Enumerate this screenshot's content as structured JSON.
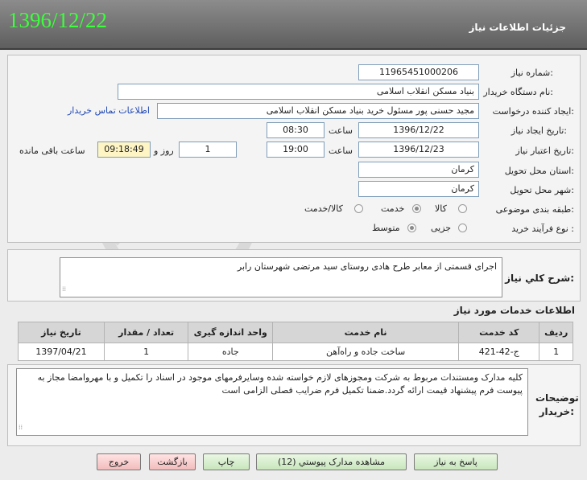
{
  "header": {
    "title": "جزئیات اطلاعات نیاز",
    "date": "1396/12/22"
  },
  "form": {
    "need_number_label": "شماره نیاز:",
    "need_number": "11965451000206",
    "buyer_org_label": "نام دستگاه خریدار:",
    "buyer_org": "بنیاد مسکن انقلاب اسلامی",
    "requester_label": "ایجاد کننده درخواست:",
    "requester": "مجید حسنی پور مسئول خرید بنیاد مسکن انقلاب اسلامی",
    "contact_link": "اطلاعات تماس خریدار",
    "created_date_label": "تاریخ ایجاد نیاز:",
    "created_date": "1396/12/22",
    "time_label": "ساعت",
    "created_time": "08:30",
    "validity_label": "تاریخ اعتبار نیاز:",
    "validity_date": "1396/12/23",
    "validity_time": "19:00",
    "days_value": "1",
    "days_label": "روز و",
    "remaining_time": "09:18:49",
    "remaining_label": "ساعت باقی مانده",
    "province_label": "استان محل تحویل:",
    "province": "کرمان",
    "city_label": "شهر محل تحویل:",
    "city": "کرمان",
    "category_label": "طبقه بندی موضوعی:",
    "category_options": [
      "کالا",
      "خدمت",
      "کالا/خدمت"
    ],
    "category_selected": "خدمت",
    "process_label": "نوع فرآیند خرید :",
    "process_options": [
      "جزیی",
      "متوسط"
    ],
    "process_selected": "متوسط"
  },
  "description": {
    "label": "شرح کلي نياز:",
    "text": "اجرای قسمتی از معابر طرح هادی روستای سید مرتضی شهرستان رابر"
  },
  "services": {
    "title": "اطلاعات خدمات مورد نیاز",
    "columns": [
      "ردیف",
      "کد خدمت",
      "نام خدمت",
      "واحد اندازه گیری",
      "تعداد / مقدار",
      "تاریخ نیاز"
    ],
    "rows": [
      [
        "1",
        "ج-42-421",
        "ساخت جاده و راه‌آهن",
        "جاده",
        "1",
        "1397/04/21"
      ]
    ]
  },
  "buyer_notes": {
    "label": "توضیحات خریدار:",
    "text": "کلیه مدارک ومستندات مربوط به شرکت ومجوزهای لازم خواسته شده وسایرفرمهای موجود در اسناد  را تکمیل و با مهروامضا مجاز به پیوست فرم پیشنهاد قیمت ارائه گردد.ضمنا تکمیل فرم ضرایب فصلی الزامی است"
  },
  "buttons": {
    "reply": "پاسخ به نیاز",
    "attachments": "مشاهده مدارک پیوستي (12)",
    "print": "چاپ",
    "back": "بازگشت",
    "exit": "خروج"
  },
  "colors": {
    "header_bg": "#6f6f6f",
    "date_green": "#3cff3c",
    "link_blue": "#1f47b3",
    "button_green": "#c7e6bb",
    "button_pink": "#f3bcbc",
    "remaining_yellow": "#fff5c4"
  }
}
